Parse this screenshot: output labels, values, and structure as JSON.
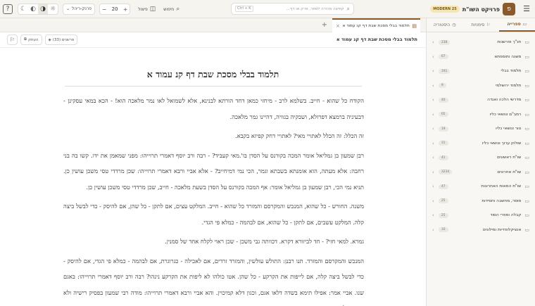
{
  "topbar": {
    "help_icon": "?",
    "theme_icons": [
      "moon-icon",
      "moon-half-icon",
      "contrast-icon",
      "sun-icon"
    ],
    "font_select": "פרנק-ריהל",
    "font_size": "20",
    "size_minus": "−",
    "size_plus": "+",
    "layout_label": "פיצול",
    "search_label": "חיפוש",
    "search_shortcut": "Ctrl + K",
    "search_placeholder": "קפיצה מהירה לספר, פרק או דף...",
    "badge": "MODERN 25",
    "brand": "פרויקט השו\"ת",
    "logo": "פ"
  },
  "sidebar": {
    "tabs": [
      {
        "label": "ספרייה",
        "icon": "folder-icon",
        "active": true
      },
      {
        "label": "סימניות",
        "icon": "bookmark-icon",
        "active": false
      },
      {
        "label": "היסטוריה",
        "icon": "clock-icon",
        "active": false
      }
    ],
    "items": [
      {
        "label": "תנ\"ך ופרשנות",
        "count": "238"
      },
      {
        "label": "משנה ותוספתא",
        "count": "67"
      },
      {
        "label": "תלמוד בבלי",
        "count": "191"
      },
      {
        "label": "תלמוד ירושלמי",
        "count": "9"
      },
      {
        "label": "מדרשי הלכה ואגדה",
        "count": "40"
      },
      {
        "label": "רמב\"ם ונושאי כליו",
        "count": "65"
      },
      {
        "label": "טור ונושאי כליו",
        "count": "19"
      },
      {
        "label": "שולחן ערוך ונושאי כליו",
        "count": "31"
      },
      {
        "label": "שו\"ת ראשונים",
        "count": "41"
      },
      {
        "label": "שו\"ת אחרונים",
        "count": "3234"
      },
      {
        "label": "שו\"ת המאות האחרונות",
        "count": "47"
      },
      {
        "label": "מוסר, מחשבה וחסידות",
        "count": "25"
      },
      {
        "label": "קבלה וספרי הסוד",
        "count": "25"
      },
      {
        "label": "אנציקלופדיות ומילונים",
        "count": "10"
      }
    ]
  },
  "tab": {
    "title": "תלמוד בבלי מסכת שבת דף קנ עמוד א",
    "close": "×",
    "add": "+"
  },
  "doc_toolbar": {
    "title": "תלמוד בבלי מסכת שבת דף קנ עמוד א",
    "commentaries": "פרשנים (33)",
    "copy": "העתק"
  },
  "document": {
    "heading": "תלמוד בבלי מסכת שבת דף קנ עמוד א",
    "paragraphs": [
      "הקודח כל שהוא - חייב. בשלמא לרב - מיחזי כמאן דחד הורתא לבנינא, אלא לשמואל לאו נמר מלאכה הוא! - הכא במאי עסקינן - דבעיניה ברמצא דפרזלא, ושבקיה בגוויה, דהיינו גמר מלאכה.",
      "זה הכלל: זה הכלל לאתויי מאי? לאתויי דחק קפיזא בקבא.",
      "רבן שמעון בן גמליאל אומר המכה בקורנס על הסדן בו'.מאי קעביד? - רבה ורב יוסף דאמרי תרוייהו: מפני שמאמן את ידו. קשו בה בני רחבה: אלא מעתה, הוא אומנתא בשבתא וגמר, הכי נמי דמיחייב? - אלא אביי ורבא דאמרי תרוייהו: שכן מרדדי טסי משכן עושין כן. תניא נמי הכי, רבן שמעון בן גמליאל אומר: אף המכה בקורנס על הסדן בשעת מלאכה - חייב, שכן מרדדי טסי משכן עושין כן.",
      "משנה. החורש - כל שהוא, המנכש והמקרסם והמזרד כל שהוא - חייב. המלקט עצים, אם לתקן - כל שהן, אם להיסק - כדי לבשל ביצה קלה. המלקט עשבים, אם לתקן - כל שהוא, אם לבהמה - כמלא פי הגדי.",
      "גמרא. למאי חזי? - חד לביזורא דקרא. דכוותה גבי משכן - שכן ראוי לקלח אחד של סמנין.",
      "המנכש והמקרסם והמזרד. תנו רבנן: התולש עולשין, והמזרד זרדים, אם לאכילה - כגרוגרת, אם לבהמה - כמלא פי הגדי, אם להיסק - כדי לבשל ביצה קלה, אם לייפות את הקרקע - כל שהן. אטו כולהו לא ליפות את הקרקע נינהו? רבה ורב יוסף דאמרי תרוייהו: באגם שנו. אביי אמר: אפילו תימא בשדה דלאו אגם, וכגון דלא קמיכוין. והא אביי ורבא דאמרי תרוייהו: מודה רבי שמעון בפסיק רישיה ולא ימות! - לא צריכא, דקעביד בארעא דחבריה."
    ]
  }
}
